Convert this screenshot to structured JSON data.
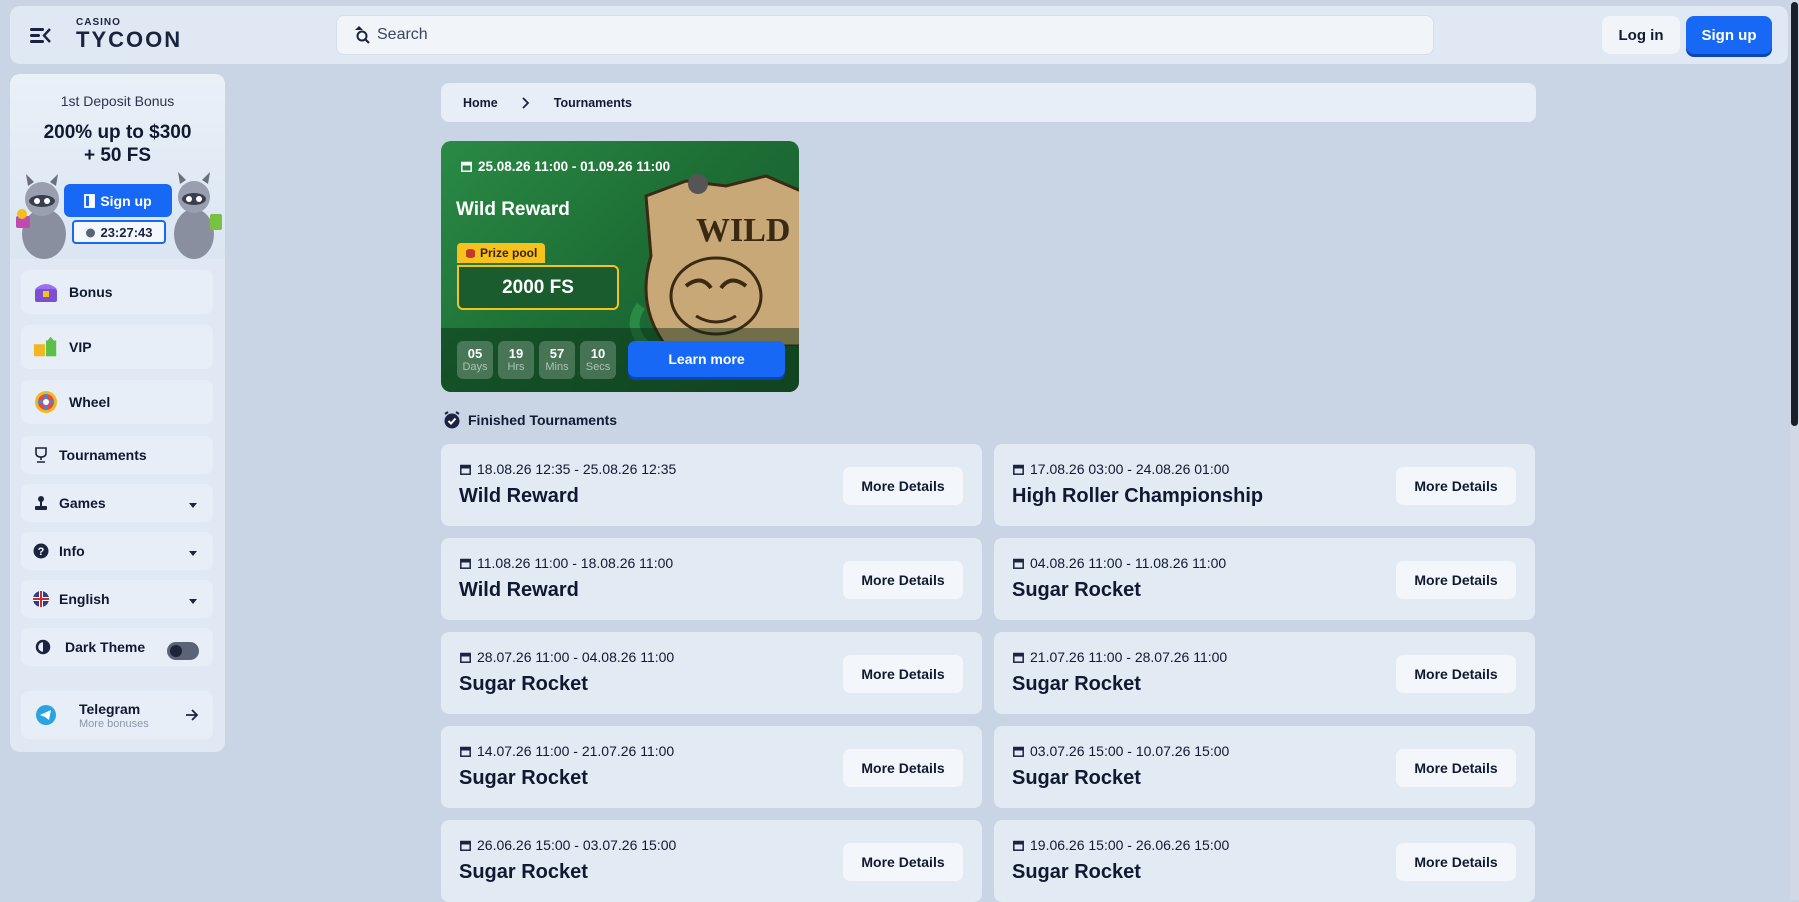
{
  "header": {
    "logo_top": "CASINO",
    "logo_main": "TYCOON",
    "search_placeholder": "Search",
    "login_label": "Log in",
    "signup_label": "Sign up"
  },
  "promo": {
    "subtitle": "1st Deposit Bonus",
    "title_line1": "200% up to $300",
    "title_line2": "+ 50 FS",
    "button_label": "Sign up",
    "timer": "23:27:43"
  },
  "sidebar": {
    "items": [
      {
        "label": "Bonus"
      },
      {
        "label": "VIP"
      },
      {
        "label": "Wheel"
      },
      {
        "label": "Tournaments"
      },
      {
        "label": "Games"
      },
      {
        "label": "Info"
      },
      {
        "label": "English"
      },
      {
        "label": "Dark Theme"
      }
    ],
    "dark_theme_enabled": false,
    "telegram": {
      "label": "Telegram",
      "sub": "More bonuses"
    }
  },
  "breadcrumb": {
    "home": "Home",
    "current": "Tournaments"
  },
  "banner": {
    "date": "25.08.26 11:00 - 01.09.26 11:00",
    "title": "Wild Reward",
    "sign_text": "WILD",
    "prize_label": "Prize pool",
    "prize_value": "2000 FS",
    "countdown": [
      {
        "value": "05",
        "unit": "Days"
      },
      {
        "value": "19",
        "unit": "Hrs"
      },
      {
        "value": "57",
        "unit": "Mins"
      },
      {
        "value": "10",
        "unit": "Secs"
      }
    ],
    "button_label": "Learn more"
  },
  "finished": {
    "heading": "Finished Tournaments",
    "more_label": "More Details",
    "cards": [
      {
        "date": "18.08.26 12:35 - 25.08.26 12:35",
        "name": "Wild Reward"
      },
      {
        "date": "17.08.26 03:00 - 24.08.26 01:00",
        "name": "High Roller Championship"
      },
      {
        "date": "11.08.26 11:00 - 18.08.26 11:00",
        "name": "Wild Reward"
      },
      {
        "date": "04.08.26 11:00 - 11.08.26 11:00",
        "name": "Sugar Rocket"
      },
      {
        "date": "28.07.26 11:00 - 04.08.26 11:00",
        "name": "Sugar Rocket"
      },
      {
        "date": "21.07.26 11:00 - 28.07.26 11:00",
        "name": "Sugar Rocket"
      },
      {
        "date": "14.07.26 11:00 - 21.07.26 11:00",
        "name": "Sugar Rocket"
      },
      {
        "date": "03.07.26 15:00 - 10.07.26 15:00",
        "name": "Sugar Rocket"
      },
      {
        "date": "26.06.26 15:00 - 03.07.26 15:00",
        "name": "Sugar Rocket"
      },
      {
        "date": "19.06.26 15:00 - 26.06.26 15:00",
        "name": "Sugar Rocket"
      }
    ]
  },
  "colors": {
    "accent": "#1768f5",
    "background": "#c9d5e5",
    "prize": "#f7c21b"
  }
}
